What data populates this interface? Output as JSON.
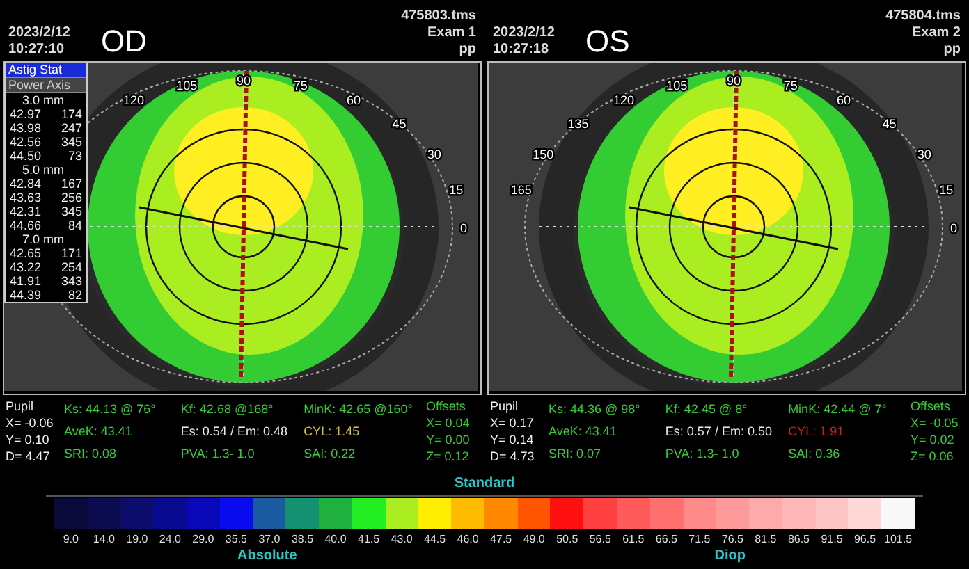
{
  "eyes": [
    {
      "date": "2023/2/12",
      "time": "10:27:10",
      "eye": "OD",
      "file": "475803.tms",
      "exam": "Exam 1",
      "operator": "pp",
      "angle_labels": [
        "0",
        "15",
        "30",
        "45",
        "60",
        "75",
        "90",
        "105",
        "120"
      ],
      "side_panel": {
        "tabs": [
          {
            "label": "Astig Stat",
            "selected": true
          },
          {
            "label": "Power Axis",
            "selected": false
          }
        ],
        "groups": [
          {
            "title": "3.0 mm",
            "rows": [
              [
                "42.97",
                "174"
              ],
              [
                "43.98",
                "247"
              ],
              [
                "42.56",
                "345"
              ],
              [
                "44.50",
                "73"
              ]
            ]
          },
          {
            "title": "5.0 mm",
            "rows": [
              [
                "42.84",
                "167"
              ],
              [
                "43.63",
                "256"
              ],
              [
                "42.31",
                "345"
              ],
              [
                "44.66",
                "84"
              ]
            ]
          },
          {
            "title": "7.0 mm",
            "rows": [
              [
                "42.65",
                "171"
              ],
              [
                "43.22",
                "254"
              ],
              [
                "41.91",
                "343"
              ],
              [
                "44.39",
                "82"
              ]
            ]
          }
        ]
      },
      "pupil": [
        "Pupil",
        "X= -0.06",
        "Y= 0.10",
        "D= 4.47"
      ],
      "stats": [
        {
          "text": "Ks: 44.13 @ 76°",
          "color": "#33cc33"
        },
        {
          "text": "Kf: 42.68 @168°",
          "color": "#33cc33"
        },
        {
          "text": "MinK: 42.65 @160°",
          "color": "#33cc33"
        },
        {
          "text": "AveK: 43.41",
          "color": "#33cc33"
        },
        {
          "text": "Es: 0.54 / Em: 0.48",
          "color": "#e8e8e8"
        },
        {
          "text": "CYL:  1.45",
          "color": "#d8c040"
        },
        {
          "text": "SRI: 0.08",
          "color": "#33cc33"
        },
        {
          "text": "PVA:  1.3-  1.0",
          "color": "#33cc33"
        },
        {
          "text": "SAI: 0.22",
          "color": "#33cc33"
        }
      ],
      "offsets": [
        "Offsets",
        "X= 0.04",
        "Y= 0.00",
        "Z= 0.12"
      ]
    },
    {
      "date": "2023/2/12",
      "time": "10:27:18",
      "eye": "OS",
      "file": "475804.tms",
      "exam": "Exam 2",
      "operator": "pp",
      "angle_labels": [
        "0",
        "15",
        "30",
        "45",
        "60",
        "75",
        "90",
        "105",
        "120",
        "135",
        "150",
        "165"
      ],
      "pupil": [
        "Pupil",
        "X= 0.17",
        "Y= 0.14",
        "D= 4.73"
      ],
      "stats": [
        {
          "text": "Ks: 44.36 @ 98°",
          "color": "#33cc33"
        },
        {
          "text": "Kf: 42.45 @  8°",
          "color": "#33cc33"
        },
        {
          "text": "MinK: 42.44 @  7°",
          "color": "#33cc33"
        },
        {
          "text": "AveK: 43.41",
          "color": "#33cc33"
        },
        {
          "text": "Es: 0.57 / Em: 0.50",
          "color": "#e8e8e8"
        },
        {
          "text": "CYL:  1.91",
          "color": "#cc2222"
        },
        {
          "text": "SRI: 0.07",
          "color": "#33cc33"
        },
        {
          "text": "PVA:  1.3-  1.0",
          "color": "#33cc33"
        },
        {
          "text": "SAI: 0.36",
          "color": "#33cc33"
        }
      ],
      "offsets": [
        "Offsets",
        "X= -0.05",
        "Y= 0.02",
        "Z= 0.06"
      ]
    }
  ],
  "scale": {
    "title": "Standard",
    "left_caption": "Absolute",
    "right_caption": "Diop",
    "steps": [
      {
        "label": "9.0",
        "color": "#0a0a3a"
      },
      {
        "label": "14.0",
        "color": "#0c0c50"
      },
      {
        "label": "19.0",
        "color": "#0c0c6a"
      },
      {
        "label": "24.0",
        "color": "#0a0a90"
      },
      {
        "label": "29.0",
        "color": "#0808b8"
      },
      {
        "label": "35.5",
        "color": "#0a0aee"
      },
      {
        "label": "37.0",
        "color": "#1a5aa0"
      },
      {
        "label": "38.5",
        "color": "#159070"
      },
      {
        "label": "40.0",
        "color": "#20b040"
      },
      {
        "label": "41.5",
        "color": "#22ee22"
      },
      {
        "label": "43.0",
        "color": "#aaee22"
      },
      {
        "label": "44.5",
        "color": "#ffee00"
      },
      {
        "label": "46.0",
        "color": "#ffbb00"
      },
      {
        "label": "47.5",
        "color": "#ff8800"
      },
      {
        "label": "49.0",
        "color": "#ff5500"
      },
      {
        "label": "50.5",
        "color": "#ff1010"
      },
      {
        "label": "56.5",
        "color": "#ff4040"
      },
      {
        "label": "61.5",
        "color": "#ff5a5a"
      },
      {
        "label": "66.5",
        "color": "#ff7070"
      },
      {
        "label": "71.5",
        "color": "#ff8a8a"
      },
      {
        "label": "76.5",
        "color": "#ff9a9a"
      },
      {
        "label": "81.5",
        "color": "#ffaaaa"
      },
      {
        "label": "86.5",
        "color": "#ffb8b8"
      },
      {
        "label": "91.5",
        "color": "#ffc6c6"
      },
      {
        "label": "96.5",
        "color": "#ffd8d8"
      },
      {
        "label": "101.5",
        "color": "#f8f8f8"
      }
    ]
  }
}
